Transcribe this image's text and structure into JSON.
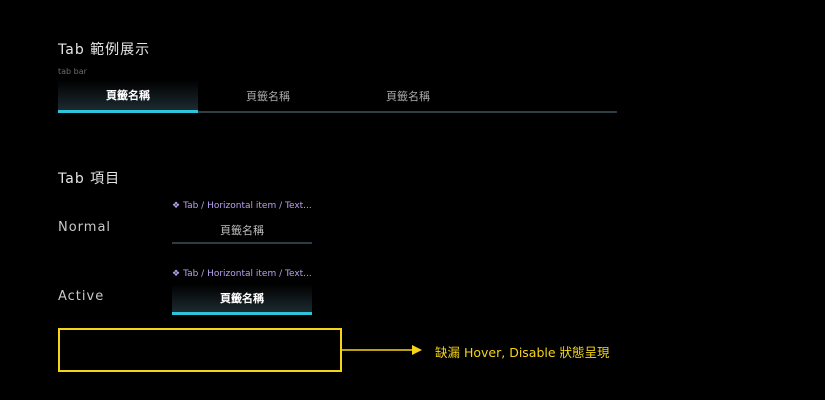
{
  "sections": {
    "example_title": "Tab 範例展示",
    "items_title": "Tab 項目"
  },
  "tabbar": {
    "caption": "tab bar",
    "tabs": [
      {
        "label": "頁籤名稱",
        "active": true
      },
      {
        "label": "頁籤名稱",
        "active": false
      },
      {
        "label": "頁籤名稱",
        "active": false
      }
    ]
  },
  "states": {
    "normal": {
      "label": "Normal",
      "component_name": "Tab / Horizontal item / Text...",
      "tab_label": "頁籤名稱"
    },
    "active": {
      "label": "Active",
      "component_name": "Tab / Horizontal item / Text...",
      "tab_label": "頁籤名稱"
    }
  },
  "annotation": {
    "note": "缺漏 Hover, Disable 狀態呈現"
  },
  "colors": {
    "accent": "#2ec4dc",
    "underline": "#2e3d44",
    "annotation": "#f5d515",
    "component_name": "#b8a2f0",
    "background": "#000000"
  },
  "icons": {
    "component": "component-diamond-icon",
    "arrow": "arrow-right-icon"
  }
}
